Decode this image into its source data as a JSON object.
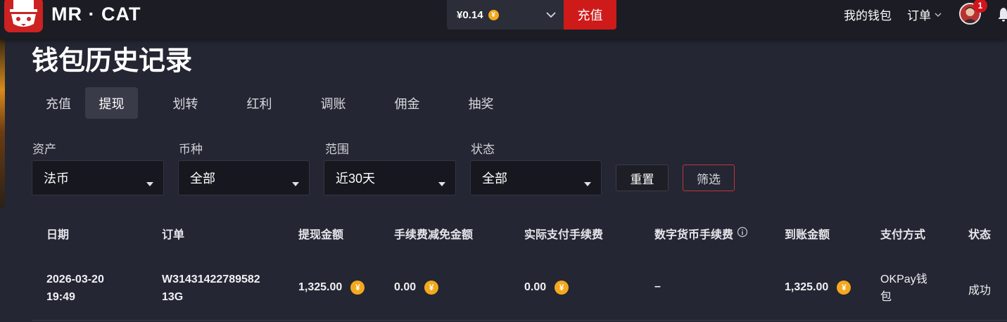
{
  "header": {
    "brand": "MR · CAT",
    "balance": "¥0.14",
    "coin_symbol": "¥",
    "deposit_label": "充值",
    "my_wallet_label": "我的钱包",
    "orders_label": "订单",
    "notification_count": "1"
  },
  "page": {
    "title": "钱包历史记录"
  },
  "tabs": [
    {
      "label": "充值",
      "active": false
    },
    {
      "label": "提现",
      "active": true
    },
    {
      "label": "划转",
      "active": false
    },
    {
      "label": "红利",
      "active": false
    },
    {
      "label": "调账",
      "active": false
    },
    {
      "label": "佣金",
      "active": false
    },
    {
      "label": "抽奖",
      "active": false
    }
  ],
  "filters": {
    "asset": {
      "label": "资产",
      "value": "法币"
    },
    "currency": {
      "label": "币种",
      "value": "全部"
    },
    "range": {
      "label": "范围",
      "value": "近30天"
    },
    "status": {
      "label": "状态",
      "value": "全部"
    },
    "reset_label": "重置",
    "filter_label": "筛选"
  },
  "table": {
    "columns": [
      "日期",
      "订单",
      "提现金额",
      "手续费减免金额",
      "实际支付手续费",
      "数字货币手续费",
      "到账金额",
      "支付方式",
      "状态"
    ],
    "rows": [
      {
        "date_line1": "2026-03-20",
        "date_line2": "19:49",
        "order_line1": "W31431422789582",
        "order_line2": "13G",
        "withdraw_amount": "1,325.00",
        "fee_discount": "0.00",
        "actual_fee": "0.00",
        "crypto_fee": "–",
        "received_amount": "1,325.00",
        "payment_line1": "OKPay钱",
        "payment_line2": "包",
        "status": "成功"
      }
    ]
  },
  "colors": {
    "accent_red": "#cf1a1a",
    "coin_gold": "#f4a81d",
    "background": "#242633",
    "topbar": "#1b1c24"
  }
}
